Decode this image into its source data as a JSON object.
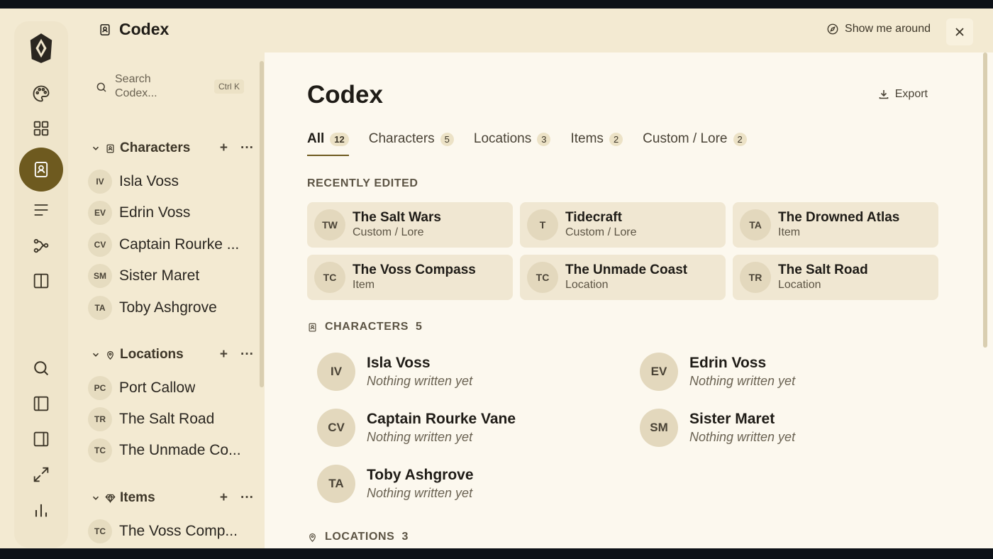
{
  "app": {
    "title": "Codex",
    "tour_label": "Show me around"
  },
  "sidebar": {
    "search_placeholder": "Search Codex...",
    "search_shortcut": "Ctrl K",
    "groups": [
      {
        "label": "Characters",
        "items": [
          {
            "initials": "IV",
            "label": "Isla Voss"
          },
          {
            "initials": "EV",
            "label": "Edrin Voss"
          },
          {
            "initials": "CV",
            "label": "Captain Rourke ..."
          },
          {
            "initials": "SM",
            "label": "Sister Maret"
          },
          {
            "initials": "TA",
            "label": "Toby Ashgrove"
          }
        ]
      },
      {
        "label": "Locations",
        "items": [
          {
            "initials": "PC",
            "label": "Port Callow"
          },
          {
            "initials": "TR",
            "label": "The Salt Road"
          },
          {
            "initials": "TC",
            "label": "The Unmade Co..."
          }
        ]
      },
      {
        "label": "Items",
        "items": [
          {
            "initials": "TC",
            "label": "The Voss Comp..."
          }
        ]
      }
    ],
    "add_glyph": "+",
    "more_glyph": "···"
  },
  "main": {
    "title": "Codex",
    "export_label": "Export",
    "tabs": [
      {
        "label": "All",
        "count": "12"
      },
      {
        "label": "Characters",
        "count": "5"
      },
      {
        "label": "Locations",
        "count": "3"
      },
      {
        "label": "Items",
        "count": "2"
      },
      {
        "label": "Custom / Lore",
        "count": "2"
      }
    ],
    "recent_label": "RECENTLY EDITED",
    "recent": [
      {
        "initials": "TW",
        "title": "The Salt Wars",
        "type": "Custom / Lore"
      },
      {
        "initials": "T",
        "title": "Tidecraft",
        "type": "Custom / Lore"
      },
      {
        "initials": "TA",
        "title": "The Drowned Atlas",
        "type": "Item"
      },
      {
        "initials": "TC",
        "title": "The Voss Compass",
        "type": "Item"
      },
      {
        "initials": "TC",
        "title": "The Unmade Coast",
        "type": "Location"
      },
      {
        "initials": "TR",
        "title": "The Salt Road",
        "type": "Location"
      }
    ],
    "characters_label": "CHARACTERS",
    "characters_count": "5",
    "characters": [
      {
        "initials": "IV",
        "name": "Isla Voss",
        "note": "Nothing written yet"
      },
      {
        "initials": "EV",
        "name": "Edrin Voss",
        "note": "Nothing written yet"
      },
      {
        "initials": "CV",
        "name": "Captain Rourke Vane",
        "note": "Nothing written yet"
      },
      {
        "initials": "SM",
        "name": "Sister Maret",
        "note": "Nothing written yet"
      },
      {
        "initials": "TA",
        "name": "Toby Ashgrove",
        "note": "Nothing written yet"
      }
    ],
    "locations_label": "LOCATIONS",
    "locations_count": "3"
  },
  "colors": {
    "accent": "#6e5a1f",
    "sidebar_bg": "#f3ead2",
    "main_bg": "#fcf8ee",
    "card_bg": "#f0e7d2"
  }
}
